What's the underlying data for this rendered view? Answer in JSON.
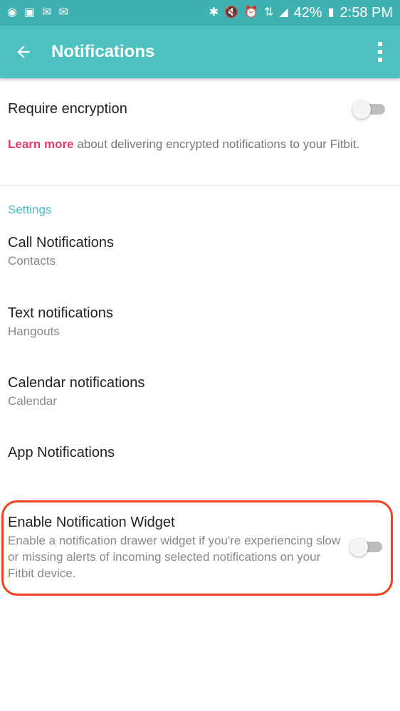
{
  "status_bar": {
    "battery": "42%",
    "time": "2:58 PM",
    "left_icons": [
      "chat-icon",
      "news-icon",
      "gmail-icon",
      "email-icon"
    ],
    "right_icons": [
      "bluetooth-icon",
      "mute-icon",
      "alarm-icon",
      "data-icon",
      "signal-icon",
      "battery-icon"
    ]
  },
  "app_bar": {
    "title": "Notifications",
    "color": "#4dc2c1"
  },
  "encryption": {
    "label": "Require encryption",
    "enabled": false,
    "learn_link": "Learn more",
    "learn_text": " about delivering encrypted notifications to your Fitbit."
  },
  "settings": {
    "header": "Settings",
    "items": [
      {
        "title": "Call Notifications",
        "subtitle": "Contacts"
      },
      {
        "title": "Text notifications",
        "subtitle": "Hangouts"
      },
      {
        "title": "Calendar notifications",
        "subtitle": "Calendar"
      },
      {
        "title": "App Notifications",
        "subtitle": ""
      }
    ]
  },
  "widget": {
    "title": "Enable Notification Widget",
    "description": "Enable a notification drawer widget if you're experiencing slow or missing alerts of incoming selected notifications on your Fitbit device.",
    "enabled": false,
    "highlight_color": "#f0411f"
  }
}
